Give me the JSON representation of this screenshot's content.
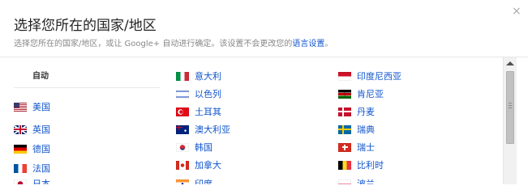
{
  "dialog": {
    "title": "选择您所在的国家/地区",
    "close_label": "×",
    "subtitle_text": "选择您所在的国家/地区，或让 Google+ 自动进行确定。该设置不会更改您的",
    "subtitle_link": "语言设置",
    "subtitle_end": "。"
  },
  "auto_label": "自动",
  "columns": [
    [
      {
        "label": "美国",
        "flag": "us-flag"
      },
      {
        "label": "英国",
        "flag": "uk-flag"
      },
      {
        "label": "德国",
        "flag": "de-flag"
      },
      {
        "label": "法国",
        "flag": "fr-flag"
      },
      {
        "label": "日本",
        "flag": "jp-flag"
      }
    ],
    [
      {
        "label": "意大利",
        "flag": "it-flag"
      },
      {
        "label": "以色列",
        "flag": "il-flag"
      },
      {
        "label": "土耳其",
        "flag": "tr-flag"
      },
      {
        "label": "澳大利亚",
        "flag": "au-flag"
      },
      {
        "label": "韩国",
        "flag": "kr-flag"
      },
      {
        "label": "加拿大",
        "flag": "ca-flag"
      },
      {
        "label": "印度",
        "flag": "in-flag"
      }
    ],
    [
      {
        "label": "印度尼西亚",
        "flag": "id-flag"
      },
      {
        "label": "肯尼亚",
        "flag": "ke-flag"
      },
      {
        "label": "丹麦",
        "flag": "dk-flag"
      },
      {
        "label": "瑞典",
        "flag": "se-flag"
      },
      {
        "label": "瑞士",
        "flag": "ch-flag"
      },
      {
        "label": "比利时",
        "flag": "be-flag"
      },
      {
        "label": "波兰",
        "flag": "pl-flag"
      }
    ]
  ]
}
